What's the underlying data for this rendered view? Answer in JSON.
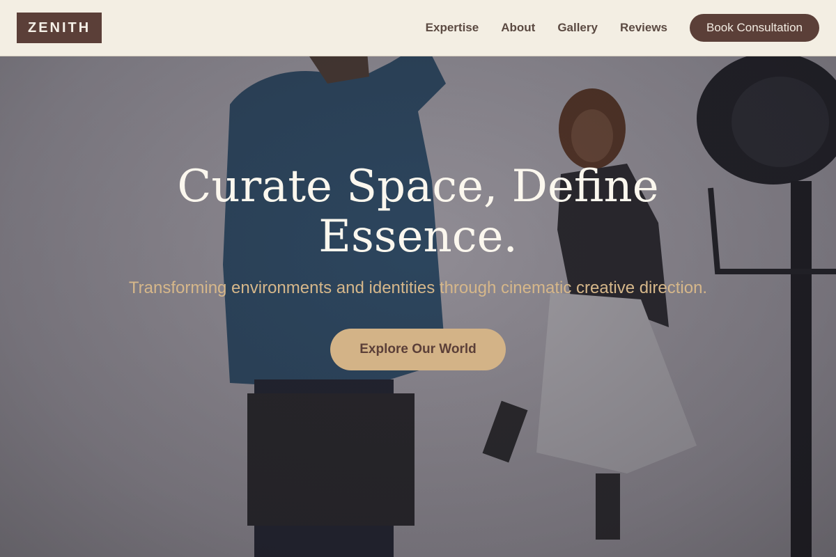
{
  "header": {
    "logo_text": "ZENITH",
    "nav": [
      {
        "label": "Expertise"
      },
      {
        "label": "About"
      },
      {
        "label": "Gallery"
      },
      {
        "label": "Reviews"
      }
    ],
    "cta_label": "Book Consultation"
  },
  "hero": {
    "headline": "Curate Space, Define Essence.",
    "subheadline": "Transforming environments and identities through cinematic creative direction.",
    "button_label": "Explore Our World"
  },
  "colors": {
    "brand_brown": "#5b3f38",
    "header_bg": "#f3eee3",
    "accent_tan": "#d3b387",
    "headline": "#fbf7ee",
    "subheadline": "#d6b78a"
  }
}
